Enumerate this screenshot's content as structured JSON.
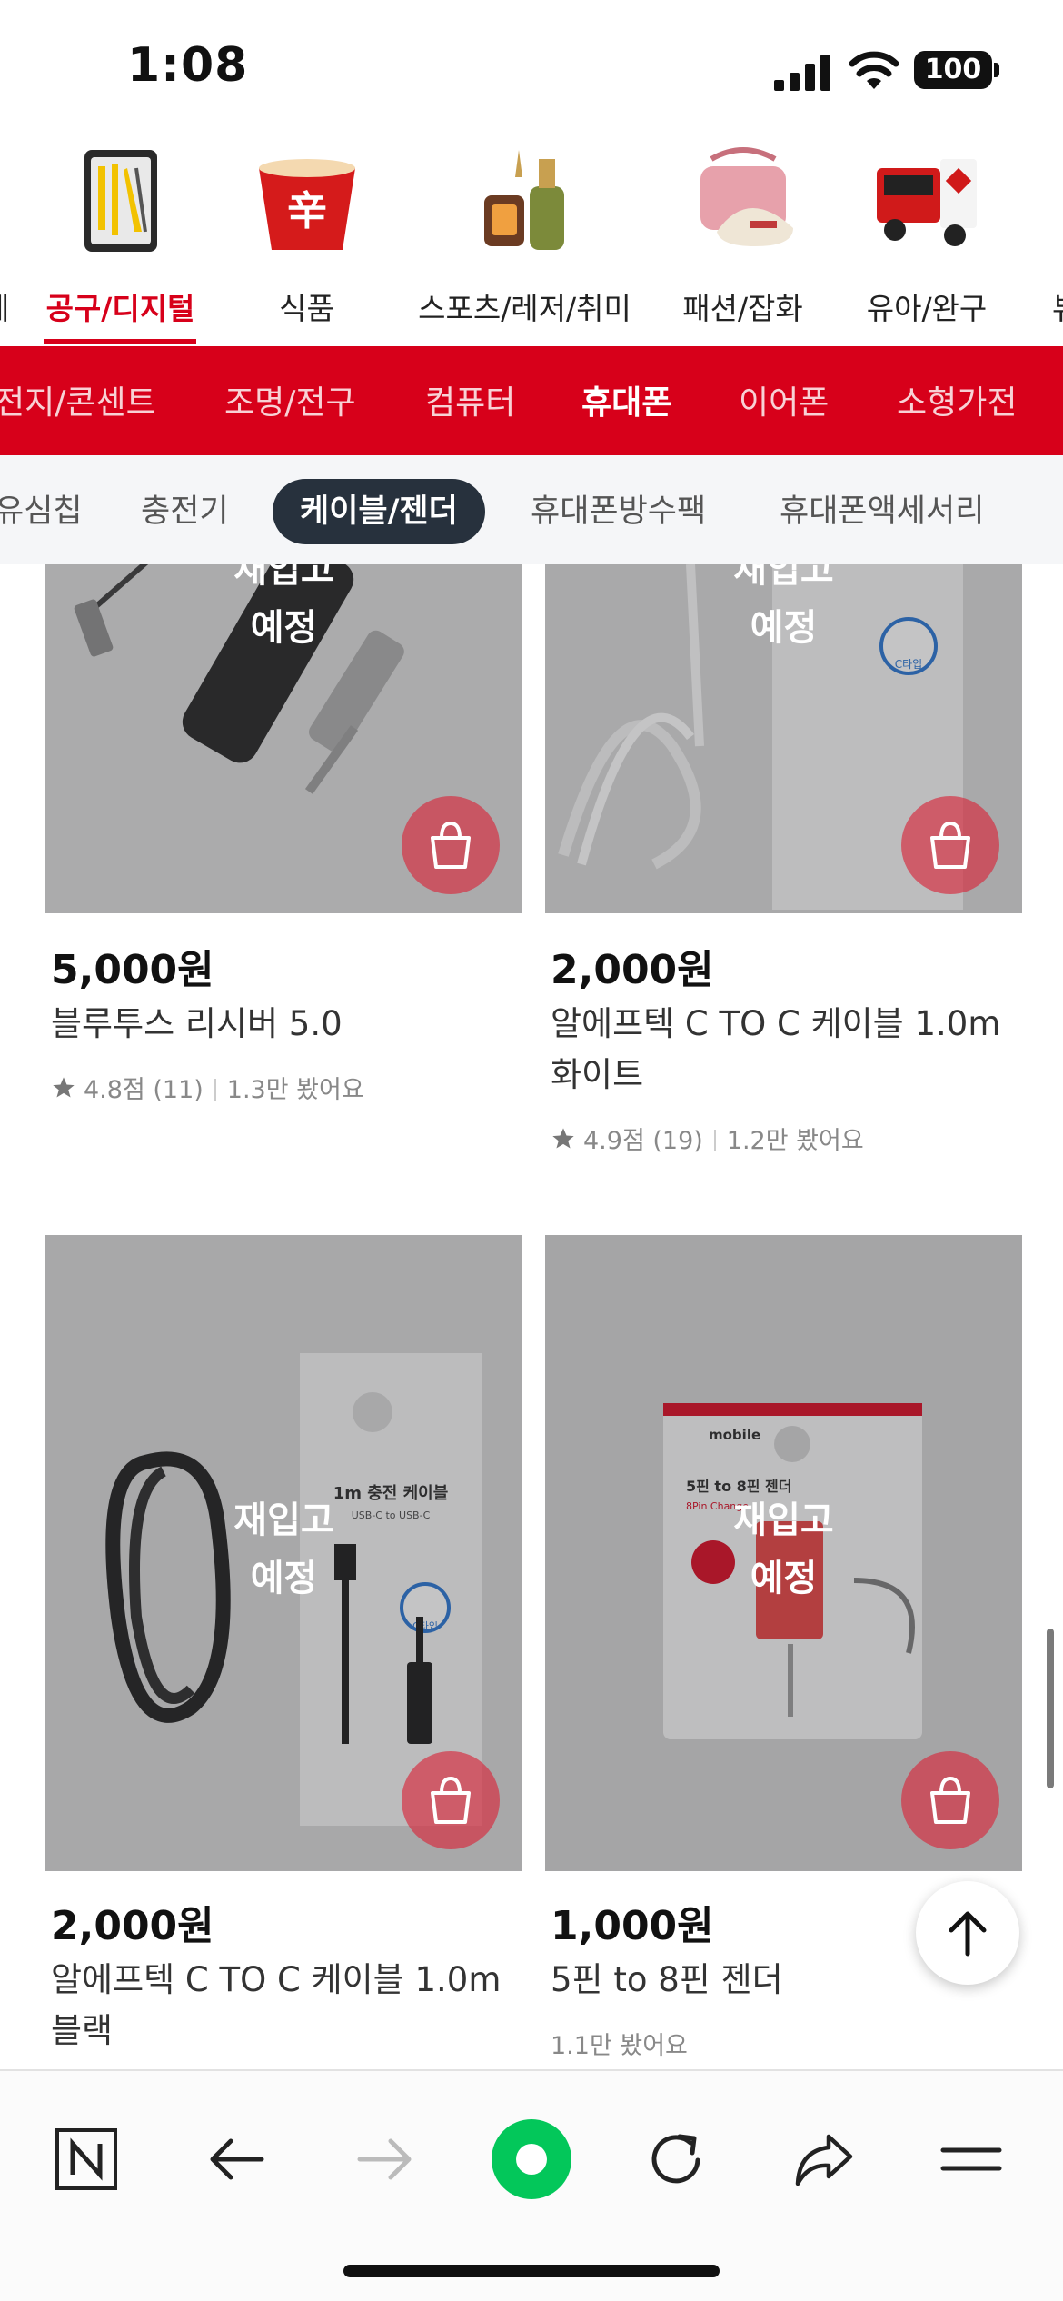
{
  "status_bar": {
    "time": "1:08",
    "battery": "100"
  },
  "categories": [
    {
      "label": "베",
      "active": false
    },
    {
      "label": "공구/디지털",
      "active": true
    },
    {
      "label": "식품",
      "active": false
    },
    {
      "label": "스포츠/레저/취미",
      "active": false
    },
    {
      "label": "패션/잡화",
      "active": false
    },
    {
      "label": "유아/완구",
      "active": false
    },
    {
      "label": "뷰",
      "active": false
    }
  ],
  "red_nav": [
    "전지/콘센트",
    "조명/전구",
    "컴퓨터",
    "휴대폰",
    "이어폰",
    "소형가전"
  ],
  "red_nav_active": "휴대폰",
  "chip_nav": [
    "유심칩",
    "충전기",
    "케이블/젠더",
    "휴대폰방수팩",
    "휴대폰액세서리"
  ],
  "chip_nav_active": "케이블/젠더",
  "restock_line1": "재입고",
  "restock_line2": "예정",
  "products": [
    {
      "price": "5,000원",
      "name": "블루투스 리시버 5.0",
      "rating": "4.8점 (11)",
      "views": "1.3만 봤어요"
    },
    {
      "price": "2,000원",
      "name": "알에프텍 C TO C 케이블 1.0m 화이트",
      "rating": "4.9점 (19)",
      "views": "1.2만 봤어요"
    },
    {
      "price": "2,000원",
      "name": "알에프텍 C TO C 케이블 1.0m 블랙",
      "rating": "",
      "views": ""
    },
    {
      "price": "1,000원",
      "name": "5핀 to 8핀 젠더",
      "rating": "",
      "views": "1.1만 봤어요"
    }
  ],
  "package_text": {
    "cable_box_title": "1m 충전 케이블",
    "cable_box_sub": "USB-C to USB-C",
    "type_badge": "C타입",
    "mobile_brand": "mobile",
    "gender_title": "5핀 to 8핀 젠더",
    "gender_sub": "8Pin Change"
  },
  "toolbar": [
    "naver-home",
    "back",
    "forward",
    "green-dot",
    "reload",
    "share",
    "menu"
  ],
  "colors": {
    "brand_red": "#d7001a",
    "chip_active": "#27313d",
    "naver_green": "#03c75a"
  }
}
